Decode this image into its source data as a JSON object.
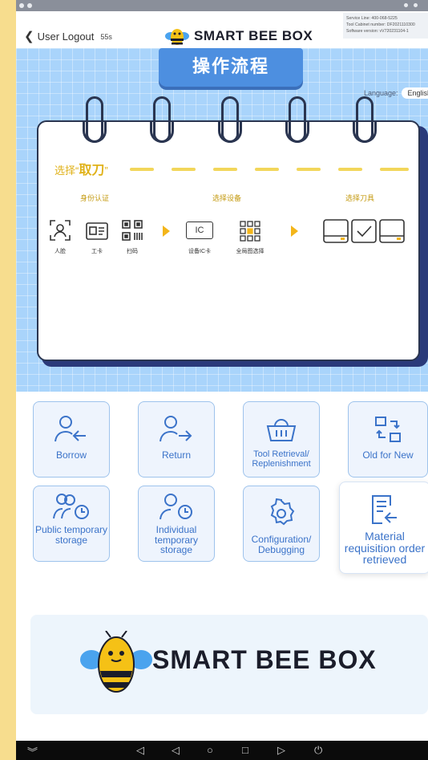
{
  "header": {
    "logout_label": "User Logout",
    "timer": "55s",
    "brand": "SMART BEE BOX",
    "service_info": [
      "Service Line: 400-068-5225",
      "Tool Cabinet number: DF2021110300",
      "Software version: vV720231104-1"
    ]
  },
  "hero": {
    "title": "操作流程",
    "language_label": "Language:",
    "language_value": "English",
    "step_prefix": "选择“",
    "step_highlight": "取刀",
    "step_suffix": "”",
    "categories": [
      "身份认证",
      "选择设备",
      "选择刀具"
    ],
    "auth_items": [
      "人脸",
      "工卡",
      "扫码"
    ],
    "device_items": [
      "设备IC卡",
      "全局图选择"
    ],
    "ic_text": "IC"
  },
  "menu": {
    "items": [
      {
        "label": "Borrow",
        "icon": "user-arrow-in-icon"
      },
      {
        "label": "Return",
        "icon": "user-arrow-out-icon"
      },
      {
        "label": "Tool Retrieval/ Replenishment",
        "icon": "basket-icon"
      },
      {
        "label": "Old for New",
        "icon": "swap-icon"
      },
      {
        "label": "Public temporary storage",
        "icon": "users-clock-icon"
      },
      {
        "label": "Individual temporary storage",
        "icon": "user-clock-icon"
      },
      {
        "label": "Configuration/ Debugging",
        "icon": "gear-icon"
      },
      {
        "label": "Material requisition order retrieved",
        "icon": "document-return-icon"
      }
    ]
  },
  "banner": {
    "brand": "SMART BEE BOX"
  },
  "colors": {
    "accent": "#3b73c9",
    "hero_bg": "#a9d4fb",
    "highlight": "#e0b21a",
    "page_bg": "#f7dd8e"
  }
}
